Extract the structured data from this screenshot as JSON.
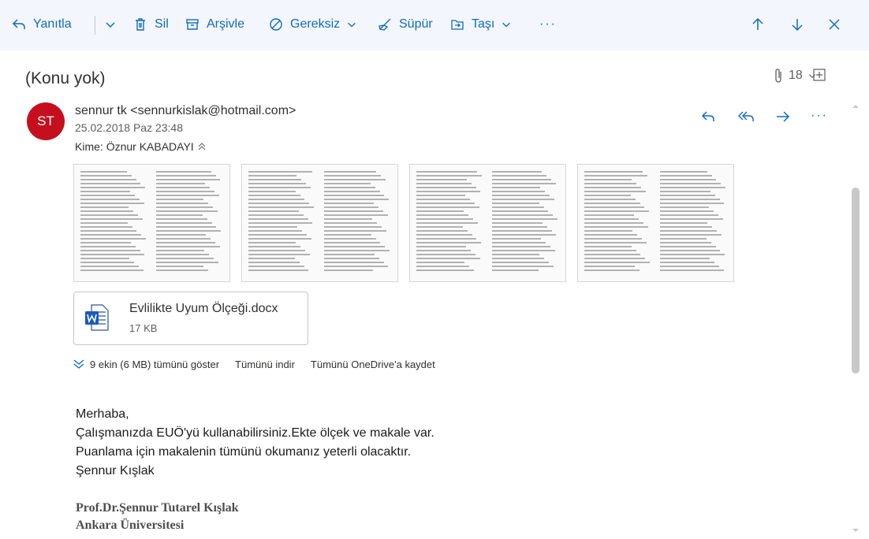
{
  "toolbar": {
    "reply_label": "Yanıtla",
    "delete_label": "Sil",
    "archive_label": "Arşivle",
    "junk_label": "Gereksiz",
    "sweep_label": "Süpür",
    "move_label": "Taşı",
    "more_label": "···"
  },
  "subject": {
    "title": "(Konu yok)",
    "attachment_count": "18"
  },
  "message": {
    "avatar_initials": "ST",
    "avatar_color": "#c50f1f",
    "sender": "sennur tk <sennurkislak@hotmail.com>",
    "date": "25.02.2018 Paz 23:48",
    "to_label": "Kime:",
    "to_name": "Öznur KABADAYI"
  },
  "attachment": {
    "name": "Evlilikte Uyum Ölçeği.docx",
    "size": "17 KB",
    "icon": "word-icon"
  },
  "attachment_links": {
    "show_all": "9 ekin (6 MB) tümünü göster",
    "download_all": "Tümünü indir",
    "save_onedrive": "Tümünü OneDrive'a kaydet"
  },
  "body": {
    "greeting": "Merhaba,",
    "line1": "Çalışmanızda EUÖ'yü kullanabilirsiniz.Ekte ölçek ve makale var.",
    "line2": "Puanlama için makalenin tümünü okumanız yeterli olacaktır.",
    "line3": "Şennur Kışlak"
  },
  "signature": {
    "name": "Prof.Dr.Şennur Tutarel Kışlak",
    "org": "Ankara Üniversitesi"
  },
  "colors": {
    "accent": "#0f6cbd",
    "toolbar_bg": "#f3f6fc"
  }
}
